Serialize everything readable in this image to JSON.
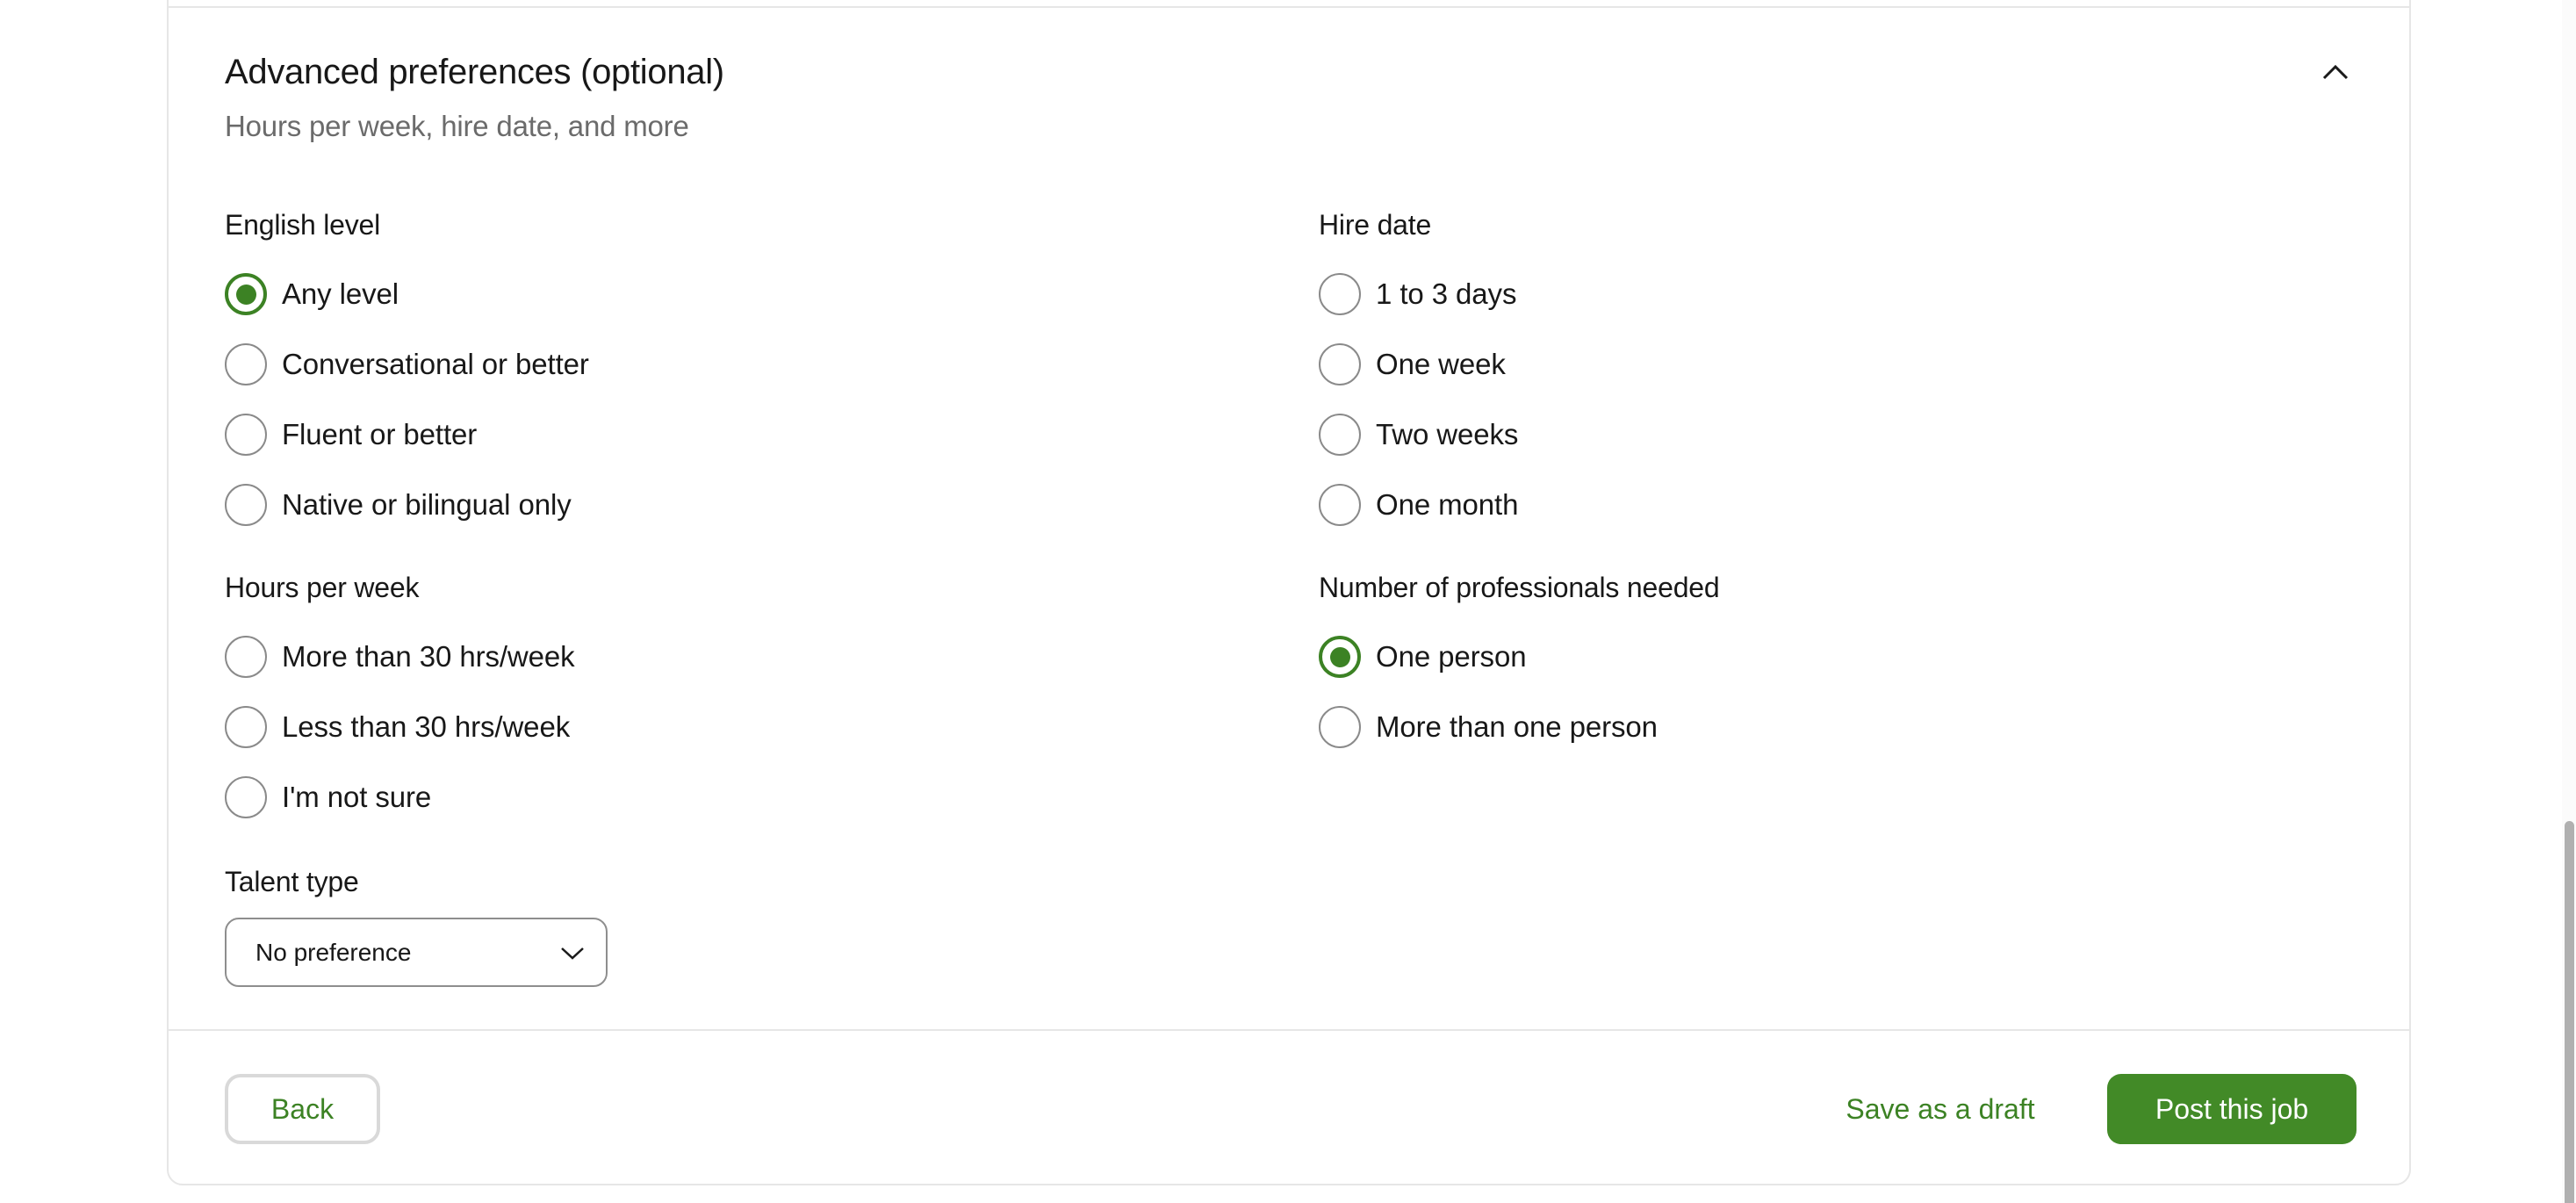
{
  "section": {
    "title": "Advanced preferences (optional)",
    "subtitle": "Hours per week, hire date, and more",
    "collapse_icon": "chevron-up-icon",
    "expanded": true
  },
  "english_level": {
    "label": "English level",
    "options": [
      {
        "label": "Any level",
        "checked": true
      },
      {
        "label": "Conversational or better",
        "checked": false
      },
      {
        "label": "Fluent or better",
        "checked": false
      },
      {
        "label": "Native or bilingual only",
        "checked": false
      }
    ]
  },
  "hire_date": {
    "label": "Hire date",
    "options": [
      {
        "label": "1 to 3 days",
        "checked": false
      },
      {
        "label": "One week",
        "checked": false
      },
      {
        "label": "Two weeks",
        "checked": false
      },
      {
        "label": "One month",
        "checked": false
      }
    ]
  },
  "hours_per_week": {
    "label": "Hours per week",
    "options": [
      {
        "label": "More than 30 hrs/week",
        "checked": false
      },
      {
        "label": "Less than 30 hrs/week",
        "checked": false
      },
      {
        "label": "I'm not sure",
        "checked": false
      }
    ]
  },
  "professionals_needed": {
    "label": "Number of professionals needed",
    "options": [
      {
        "label": "One person",
        "checked": true
      },
      {
        "label": "More than one person",
        "checked": false
      }
    ]
  },
  "talent_type": {
    "label": "Talent type",
    "selected": "No preference",
    "dropdown_icon": "chevron-down-icon"
  },
  "footer": {
    "back_label": "Back",
    "draft_label": "Save as a draft",
    "post_label": "Post this job"
  },
  "colors": {
    "accent": "#428a27",
    "radio_checked": "#3c8224",
    "text_primary": "#181818",
    "text_secondary": "#6b6b6b",
    "border": "#e6e6e6"
  }
}
